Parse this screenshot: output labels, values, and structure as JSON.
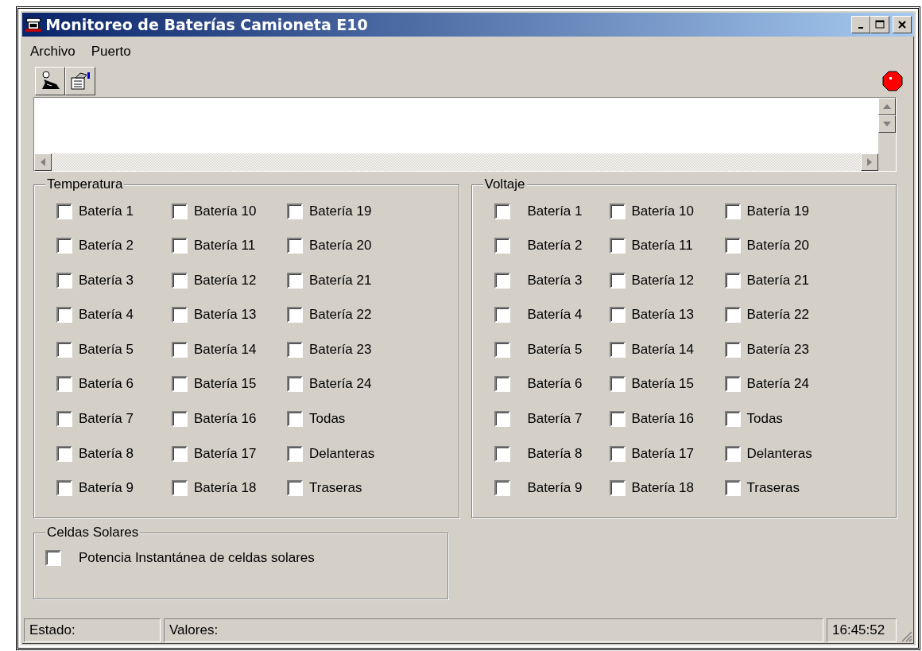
{
  "window": {
    "title": "Monitoreo de Baterías Camioneta E10"
  },
  "menu": [
    {
      "label": "Archivo"
    },
    {
      "label": "Puerto"
    }
  ],
  "connection": {
    "connected": false
  },
  "groups": [
    {
      "title": "Temperatura",
      "options": [
        {
          "label": "Batería 1",
          "checked": false
        },
        {
          "label": "Batería 2",
          "checked": false
        },
        {
          "label": "Batería 3",
          "checked": false
        },
        {
          "label": "Batería 4",
          "checked": false
        },
        {
          "label": "Batería 5",
          "checked": false
        },
        {
          "label": "Batería 6",
          "checked": false
        },
        {
          "label": "Batería 7",
          "checked": false
        },
        {
          "label": "Batería 8",
          "checked": false
        },
        {
          "label": "Batería 9",
          "checked": false
        },
        {
          "label": "Batería 10",
          "checked": false
        },
        {
          "label": "Batería 11",
          "checked": false
        },
        {
          "label": "Batería 12",
          "checked": false
        },
        {
          "label": "Batería 13",
          "checked": false
        },
        {
          "label": "Batería 14",
          "checked": false
        },
        {
          "label": "Batería 15",
          "checked": false
        },
        {
          "label": "Batería 16",
          "checked": false
        },
        {
          "label": "Batería 17",
          "checked": false
        },
        {
          "label": "Batería 18",
          "checked": false
        },
        {
          "label": "Batería 19",
          "checked": false
        },
        {
          "label": "Batería 20",
          "checked": false
        },
        {
          "label": "Batería 21",
          "checked": false
        },
        {
          "label": "Batería 22",
          "checked": false
        },
        {
          "label": "Batería 23",
          "checked": false
        },
        {
          "label": "Batería 24",
          "checked": false
        },
        {
          "label": "Todas",
          "checked": false
        },
        {
          "label": "Delanteras",
          "checked": false
        },
        {
          "label": "Traseras",
          "checked": false
        }
      ]
    },
    {
      "title": "Voltaje",
      "options": [
        {
          "label": "Batería 1",
          "checked": false
        },
        {
          "label": "Batería 2",
          "checked": false
        },
        {
          "label": "Batería 3",
          "checked": false
        },
        {
          "label": "Batería 4",
          "checked": false
        },
        {
          "label": "Batería 5",
          "checked": false
        },
        {
          "label": "Batería 6",
          "checked": false
        },
        {
          "label": "Batería 7",
          "checked": false
        },
        {
          "label": "Batería 8",
          "checked": false
        },
        {
          "label": "Batería 9",
          "checked": false
        },
        {
          "label": "Batería 10",
          "checked": false
        },
        {
          "label": "Batería 11",
          "checked": false
        },
        {
          "label": "Batería 12",
          "checked": false
        },
        {
          "label": "Batería 13",
          "checked": false
        },
        {
          "label": "Batería 14",
          "checked": false
        },
        {
          "label": "Batería 15",
          "checked": false
        },
        {
          "label": "Batería 16",
          "checked": false
        },
        {
          "label": "Batería 17",
          "checked": false
        },
        {
          "label": "Batería 18",
          "checked": false
        },
        {
          "label": "Batería 19",
          "checked": false
        },
        {
          "label": "Batería 20",
          "checked": false
        },
        {
          "label": "Batería 21",
          "checked": false
        },
        {
          "label": "Batería 22",
          "checked": false
        },
        {
          "label": "Batería 23",
          "checked": false
        },
        {
          "label": "Batería 24",
          "checked": false
        },
        {
          "label": "Todas",
          "checked": false
        },
        {
          "label": "Delanteras",
          "checked": false
        },
        {
          "label": "Traseras",
          "checked": false
        }
      ]
    }
  ],
  "solar": {
    "title": "Celdas Solares",
    "options": [
      {
        "label": "Potencia Instantánea de celdas solares",
        "checked": false
      }
    ]
  },
  "status_bar": [
    {
      "text": "Estado:"
    },
    {
      "text": "Valores:"
    },
    {
      "text": "16:45:52"
    }
  ]
}
